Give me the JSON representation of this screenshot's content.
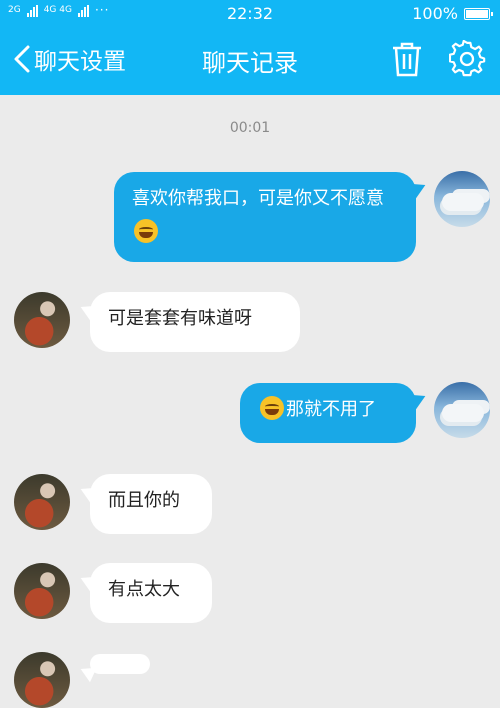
{
  "status_bar": {
    "network_left": "2G",
    "network_right": "4G 4G",
    "dots": "···",
    "time": "22:32",
    "battery": "100%",
    "battery_level": 1.0
  },
  "nav": {
    "back_label": "聊天设置",
    "title": "聊天记录",
    "icons": [
      "chevron-left-icon",
      "trash-icon",
      "gear-icon"
    ]
  },
  "timestamp": "00:01",
  "messages": [
    {
      "sender": "me",
      "text": "喜欢你帮我口，可是你又不愿意",
      "emoji": "laugh-tears-emoji"
    },
    {
      "sender": "other",
      "text": "可是套套有味道呀"
    },
    {
      "sender": "me",
      "text": "那就不用了",
      "emoji": "laugh-tears-emoji"
    },
    {
      "sender": "other",
      "text": "而且你的"
    },
    {
      "sender": "other",
      "text": "有点太大"
    }
  ],
  "colors": {
    "header": "#12b7f5",
    "my_bubble": "#19a8e7",
    "their_bubble": "#ffffff",
    "background": "#ebebeb"
  }
}
